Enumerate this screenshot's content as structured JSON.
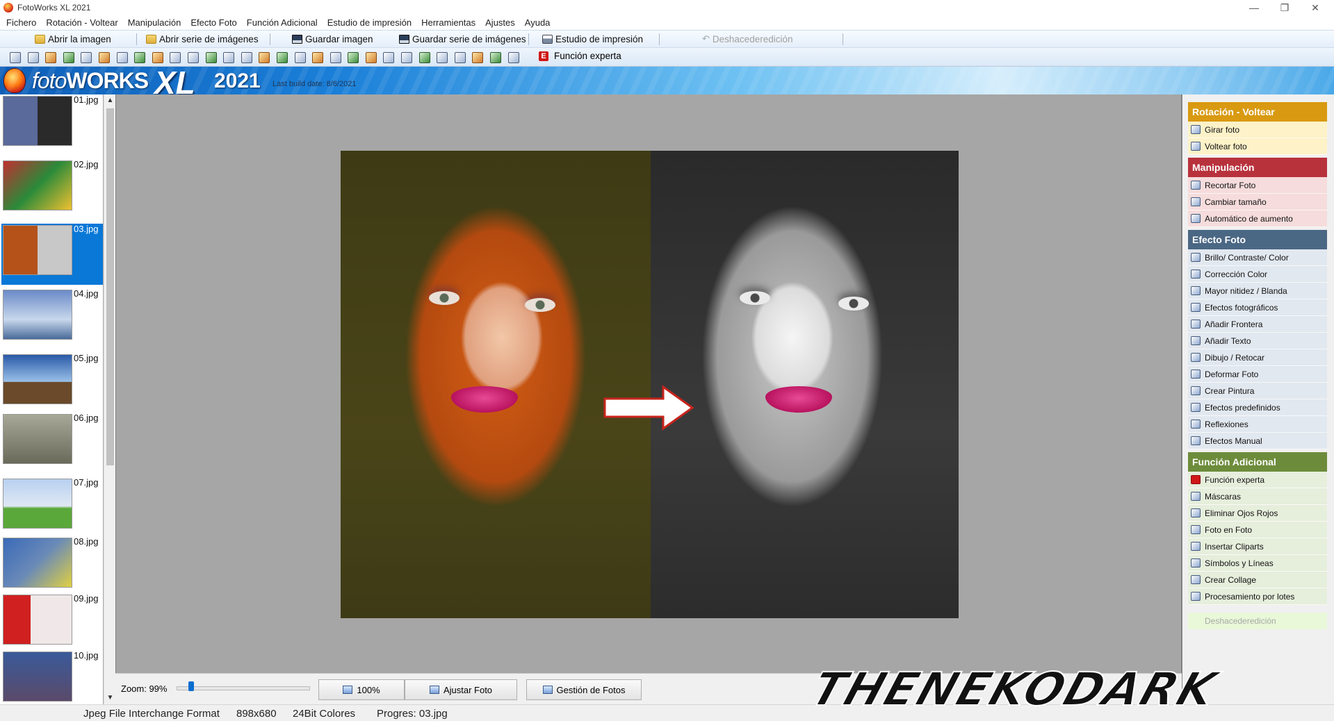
{
  "window": {
    "title": "FotoWorks XL 2021",
    "controls": [
      "minimize-icon",
      "restore-icon",
      "close-icon"
    ]
  },
  "menu": [
    "Fichero",
    "Rotación - Voltear",
    "Manipulación",
    "Efecto Foto",
    "Función Adicional",
    "Estudio de impresión",
    "Herramientas",
    "Ajustes",
    "Ayuda"
  ],
  "toolbar": {
    "open_image": "Abrir la imagen",
    "open_series": "Abrir serie de imágenes",
    "save_image": "Guardar imagen",
    "save_series": "Guardar serie de imágenes",
    "print_studio": "Estudio de impresión",
    "undo": "Deshacederedición",
    "expert": "Función experta"
  },
  "banner": {
    "brand_foto": "foto",
    "brand_works": "WORKS",
    "brand_xl": "XL",
    "brand_year": "2021",
    "build_date": "Last build date: 8/6/2021"
  },
  "thumbnails": {
    "items": [
      "01.jpg",
      "02.jpg",
      "03.jpg",
      "04.jpg",
      "05.jpg",
      "06.jpg",
      "07.jpg",
      "08.jpg",
      "09.jpg",
      "10.jpg"
    ],
    "selected": "03.jpg"
  },
  "viewer": {
    "zoom_label": "Zoom: 99%",
    "zoom_level": 0.09,
    "btn_100": "100%",
    "btn_fit": "Ajustar Foto",
    "btn_manage": "Gestión de Fotos"
  },
  "side": {
    "rotacion": {
      "title": "Rotación - Voltear",
      "items": [
        "Girar foto",
        "Voltear foto"
      ]
    },
    "manipulacion": {
      "title": "Manipulación",
      "items": [
        "Recortar Foto",
        "Cambiar  tamaño",
        "Automático de aumento"
      ]
    },
    "efecto": {
      "title": "Efecto Foto",
      "items": [
        "Brillo/ Contraste/ Color",
        "Corrección Color",
        "Mayor nitidez / Blanda",
        "Efectos fotográficos",
        "Añadir Frontera",
        "Añadir Texto",
        "Dibujo / Retocar",
        "Deformar Foto",
        "Crear Pintura",
        "Efectos predefinidos",
        "Reflexiones",
        "Efectos Manual"
      ]
    },
    "funcion": {
      "title": "Función Adicional",
      "items": [
        "Función experta",
        "Máscaras",
        "Eliminar Ojos Rojos",
        "Foto en Foto",
        "Insertar Cliparts",
        "Símbolos y Líneas",
        "Crear Collage",
        "Procesamiento por lotes"
      ]
    },
    "undo": "Deshacederedición"
  },
  "watermark": "THENEKODARK",
  "status": {
    "format": "Jpeg File Interchange Format",
    "size": "898x680",
    "colors": "24Bit Colores",
    "progress": "Progres: 03.jpg"
  },
  "colors": {
    "rotacion": "#d99a12",
    "manipulacion": "#b8323c",
    "efecto": "#4a6784",
    "funcion": "#6d8c3b",
    "selection": "#0a78d7"
  }
}
